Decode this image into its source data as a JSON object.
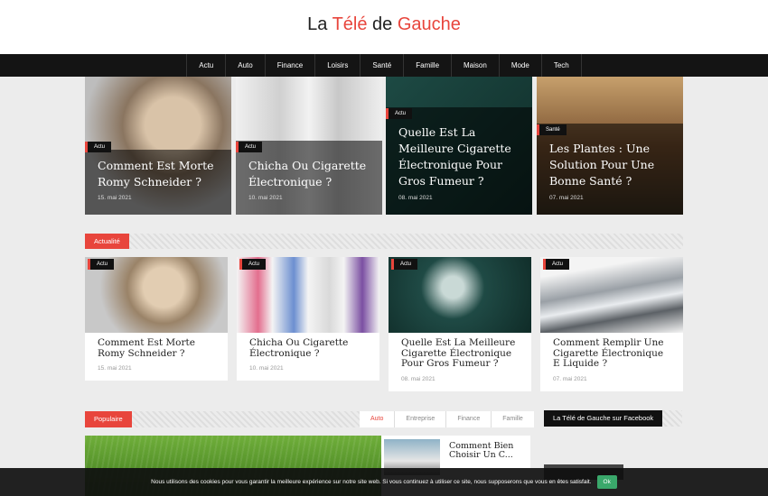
{
  "site": {
    "title_a": "La ",
    "title_b": "Télé",
    "title_c": " de ",
    "title_d": "Gauche"
  },
  "nav": [
    "Actu",
    "Auto",
    "Finance",
    "Loisirs",
    "Santé",
    "Famille",
    "Maison",
    "Mode",
    "Tech"
  ],
  "hero": [
    {
      "category": "Actu",
      "title": "Comment Est Morte Romy Schneider ?",
      "date": "15. mai 2021"
    },
    {
      "category": "Actu",
      "title": "Chicha Ou Cigarette Électronique ?",
      "date": "10. mai 2021"
    },
    {
      "category": "Actu",
      "title": "Quelle Est La Meilleure Cigarette Électronique Pour Gros Fumeur ?",
      "date": "08. mai 2021"
    },
    {
      "category": "Santé",
      "title": "Les Plantes : Une Solution Pour Une Bonne Santé ?",
      "date": "07. mai 2021"
    }
  ],
  "actualite": {
    "label": "Actualité",
    "cards": [
      {
        "category": "Actu",
        "title": "Comment Est Morte Romy Schneider ?",
        "date": "15. mai 2021"
      },
      {
        "category": "Actu",
        "title": "Chicha Ou Cigarette Électronique ?",
        "date": "10. mai 2021"
      },
      {
        "category": "Actu",
        "title": "Quelle Est La Meilleure Cigarette Électronique Pour Gros Fumeur ?",
        "date": "08. mai 2021"
      },
      {
        "category": "Actu",
        "title": "Comment Remplir Une Cigarette Électronique E Liquide ?",
        "date": "07. mai 2021"
      }
    ]
  },
  "populaire": {
    "label": "Populaire",
    "tabs": [
      "Auto",
      "Entreprise",
      "Finance",
      "Famille"
    ],
    "side_title": "Comment Bien Choisir Un C..."
  },
  "facebook": {
    "label": "La Télé de Gauche sur Facebook"
  },
  "cookie": {
    "message": "Nous utilisons des cookies pour vous garantir la meilleure expérience sur notre site web. Si vous continuez à utiliser ce site, nous supposerons que vous en êtes satisfait.",
    "ok": "Ok"
  },
  "colors": {
    "accent": "#e8453c",
    "dark": "#141414"
  }
}
